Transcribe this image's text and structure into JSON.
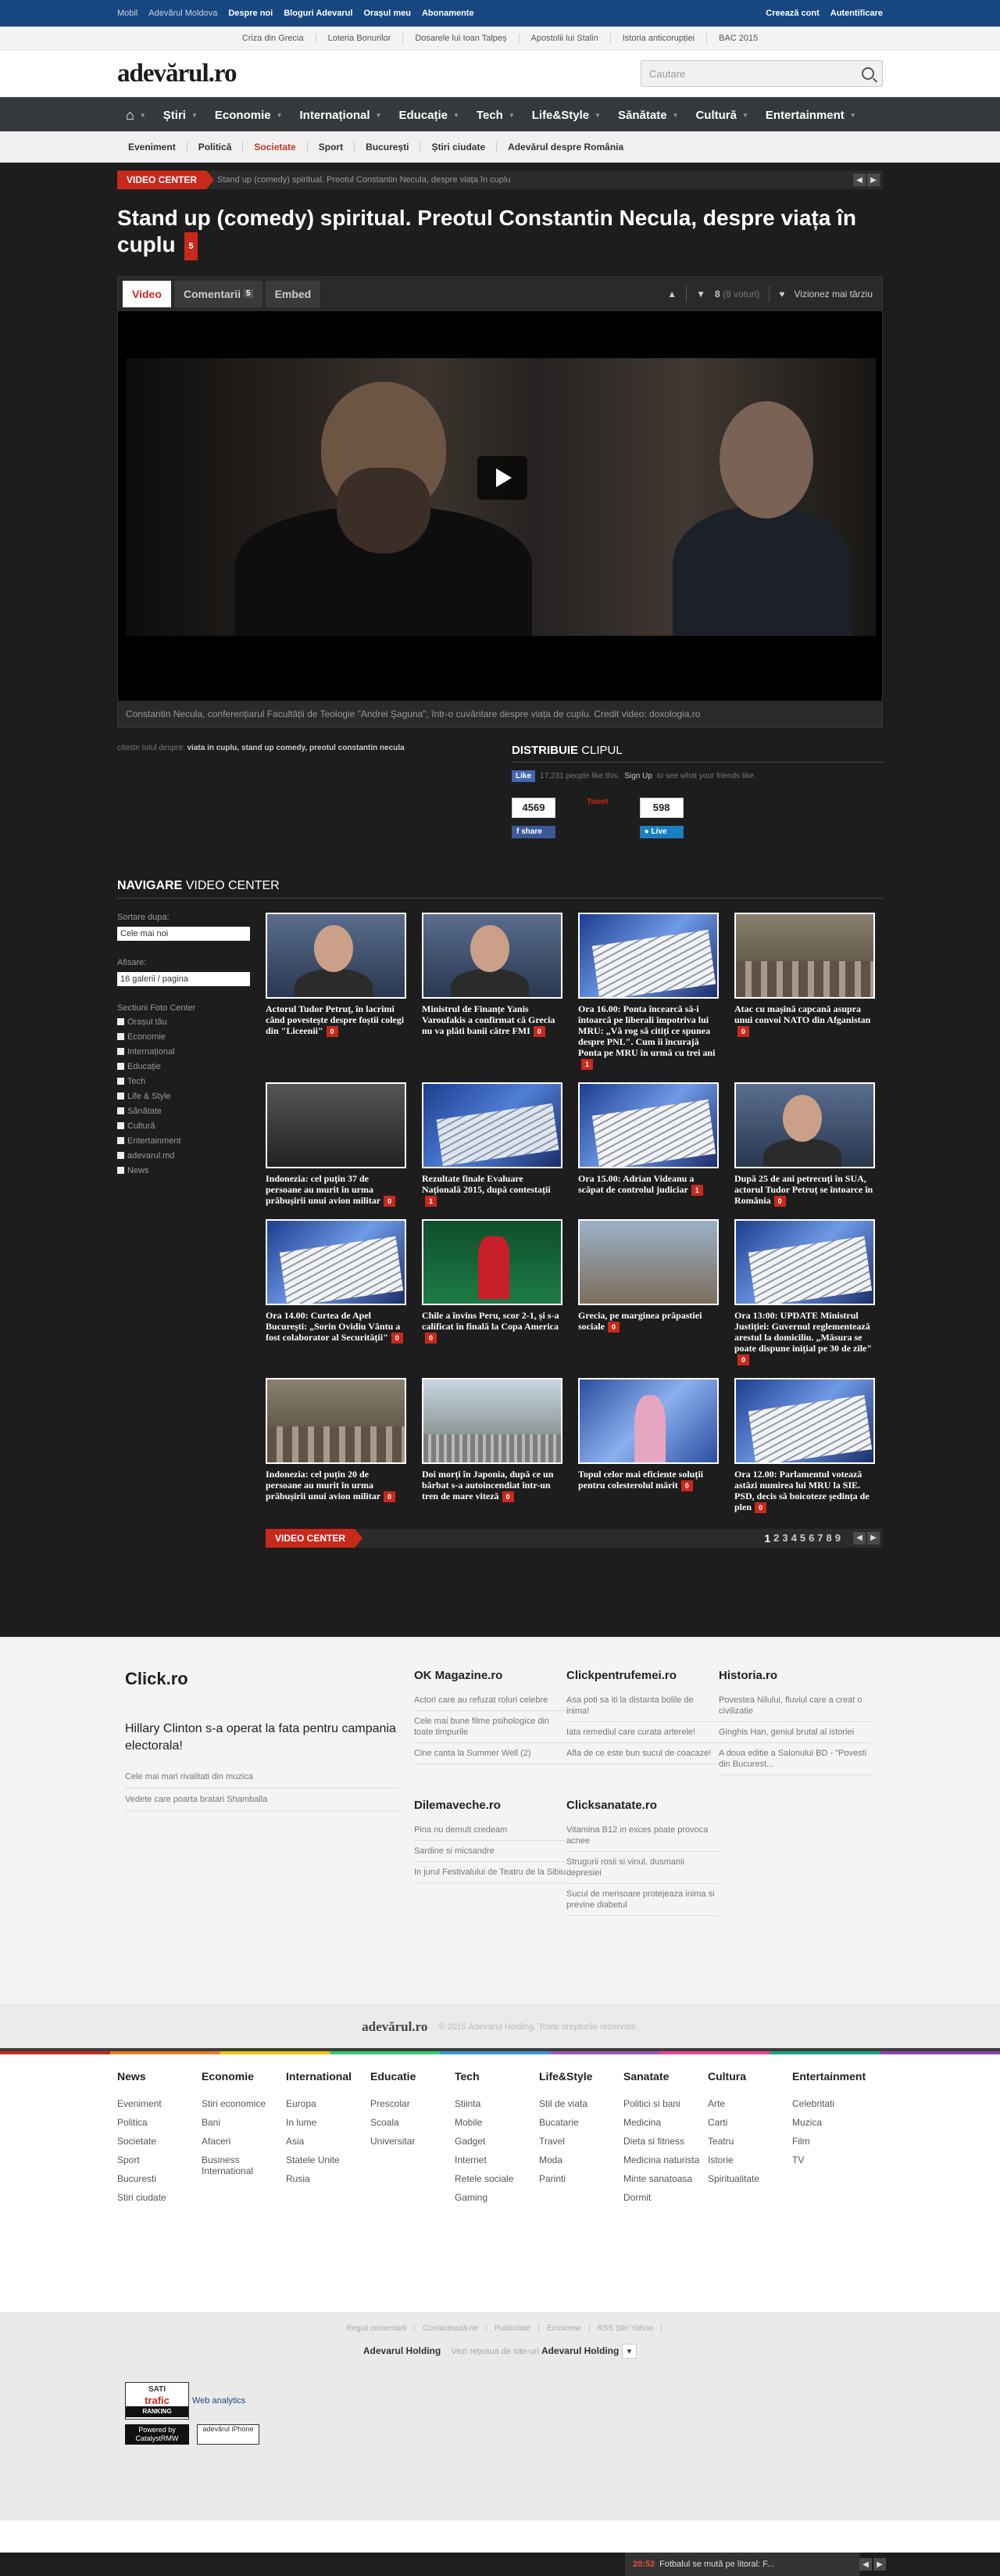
{
  "topbar": {
    "mobil": "Mobil",
    "moldova": "Adevărul Moldova",
    "despre": "Despre noi",
    "bloguri": "Bloguri Adevarul",
    "orasul": "Orașul meu",
    "abonamente": "Abonamente",
    "creeaza": "Creează cont",
    "auth": "Autentificare"
  },
  "subtop": [
    "Criza din Grecia",
    "Loteria Bonurilor",
    "Dosarele lui Ioan Talpeș",
    "Apostolii lui Stalin",
    "Istoria anticorupției",
    "BAC 2015"
  ],
  "header": {
    "logo": "adevărul.ro",
    "search_placeholder": "Cautare"
  },
  "mainnav": [
    "Știri",
    "Economie",
    "Internațional",
    "Educație",
    "Tech",
    "Life&Style",
    "Sănătate",
    "Cultură",
    "Entertainment"
  ],
  "subnav": [
    "Eveniment",
    "Politică",
    "Societate",
    "Sport",
    "București",
    "Știri ciudate",
    "Adevărul despre România"
  ],
  "videocenter": {
    "label": "VIDEO CENTER",
    "crumb": "Stand up (comedy) spiritual. Preotul Constantin Necula, despre viața în cuplu",
    "title": "Stand up (comedy) spiritual. Preotul Constantin Necula, despre viața în cuplu",
    "comments": "5"
  },
  "player": {
    "tab_video": "Video",
    "tab_comments": "Comentarii",
    "tab_comments_count": "5",
    "tab_embed": "Embed",
    "votes": "8",
    "votes_note": "(8 voturi)",
    "watch_later": "Vizionez mai târziu",
    "caption": "Constantin Necula, conferențiarul Facultății de Teologie \"Andrei Şaguna\", într-o cuvântare despre viața de cuplu. Credit video: doxologia.ro"
  },
  "tags": {
    "label": "citeste totul despre:",
    "items": "viata in cuplu, stand up comedy, preotul constantin necula"
  },
  "distribuie": {
    "title_b": "DISTRIBUIE",
    "title_n": "CLIPUL",
    "fb_like": "Like",
    "fb_text": "17,231 people like this.",
    "fb_signup": "Sign Up",
    "fb_text2": "to see what your friends like.",
    "fb_count": "4569",
    "fb_share": "share",
    "tweet": "Tweet",
    "live_count": "598",
    "live": "Live"
  },
  "navigare": {
    "title_b": "NAVIGARE",
    "title_n": "VIDEO CENTER",
    "sort_label": "Sortare dupa:",
    "sort_value": "Cele mai noi",
    "show_label": "Afisare:",
    "show_value": "16 galerii / pagina",
    "sections_label": "Sectiuni Foto Center",
    "sections": [
      "Orașul tău",
      "Economie",
      "Internațional",
      "Educație",
      "Tech",
      "Life & Style",
      "Sănătate",
      "Cultură",
      "Entertainment",
      "adevarul.md",
      "News"
    ]
  },
  "cards": [
    {
      "title": "Actorul Tudor Petruț, în lacrimi când povestește despre foștii colegi din \"Liceenii\"",
      "comments": "0"
    },
    {
      "title": "Ministrul de Finanțe Yanis Varoufakis a confirmat că Grecia nu va plăti banii către FMI",
      "comments": "0"
    },
    {
      "title": "Ora 16.00: Ponta încearcă să-i întoarcă pe liberali împotriva lui MRU: „Vă rog să citiți ce spunea despre PNL\". Cum îi încurajă Ponta pe MRU în urmă cu trei ani",
      "comments": "1"
    },
    {
      "title": "Atac cu mașină capcană asupra unui convoi NATO din Afganistan",
      "comments": "0"
    },
    {
      "title": "Indonezia: cel puțin 37 de persoane au murit în urma prăbușirii unui avion militar",
      "comments": "0"
    },
    {
      "title": "Rezultate finale Evaluare Națională 2015, după contestații",
      "comments": "1"
    },
    {
      "title": "Ora 15.00: Adrian Videanu a scăpat de controlul judiciar",
      "comments": "1"
    },
    {
      "title": "După 25 de ani petrecuți în SUA, actorul Tudor Petruț se întoarce în România",
      "comments": "0"
    },
    {
      "title": "Ora 14.00: Curtea de Apel București: „Sorin Ovidiu Vântu a fost colaborator al Securității\"",
      "comments": "0"
    },
    {
      "title": "Chile a învins Peru, scor 2-1, și s-a calificat în finală la Copa America",
      "comments": "0"
    },
    {
      "title": "Grecia, pe marginea prăpastiei sociale",
      "comments": "0"
    },
    {
      "title": "Ora 13:00: UPDATE Ministrul Justiției: Guvernul reglementează arestul la domiciliu. „Măsura se poate dispune inițial pe 30 de zile\"",
      "comments": "0"
    },
    {
      "title": "Indonezia: cel puțin 20 de persoane au murit în urma prăbușirii unui avion militar",
      "comments": "0"
    },
    {
      "title": "Doi morți în Japonia, după ce un bărbat s-a autoincendiat într-un tren de mare viteză",
      "comments": "0"
    },
    {
      "title": "Topul celor mai eficiente soluții pentru colesterolul mărit",
      "comments": "0"
    },
    {
      "title": "Ora 12.00: Parlamentul votează astăzi numirea lui MRU la SIE. PSD, decis să boicoteze ședința de plen",
      "comments": "0"
    }
  ],
  "pagination": {
    "label": "VIDEO CENTER",
    "pages": [
      "1",
      "2",
      "3",
      "4",
      "5",
      "6",
      "7",
      "8",
      "9"
    ]
  },
  "partners": {
    "main": {
      "site": "Click.ro",
      "headline": "Hillary Clinton s-a operat la fata pentru campania electorala!",
      "links": [
        "Cele mai mari rivalitati din muzica",
        "Vedete care poarta bratari Shamballa"
      ]
    },
    "cols": [
      {
        "site": "OK Magazine.ro",
        "links": [
          "Actori care au refuzat roluri celebre",
          "Cele mai bune filme psihologice din toate timpurile",
          "Cine canta la Summer Well (2)"
        ]
      },
      {
        "site": "Clickpentrufemei.ro",
        "links": [
          "Asa poti sa iti la distanta bolile de inima!",
          "Iata remediul care curata arterele!",
          "Afla de ce este bun sucul de coacaze!"
        ]
      },
      {
        "site": "Historia.ro",
        "links": [
          "Povestea Nilului, fluviul care a creat o civilizatie",
          "Ginghis Han, geniul brutal al istoriei",
          "A doua editie a Salonului BD - \"Povesti din Bucurest..."
        ]
      },
      {
        "site": "Dilemaveche.ro",
        "links": [
          "Pina nu demult credeam",
          "Sardine si micsandre",
          "In jurul Festivalului de Teatru de la Sibiu"
        ]
      },
      {
        "site": "Clicksanatate.ro",
        "links": [
          "Vitamina B12 in exces poate provoca acnee",
          "Strugurii rosii si vinul, dusmanii depresiei",
          "Sucul de merisoare protejeaza inima si previne diabetul"
        ]
      }
    ]
  },
  "copyright": {
    "logo": "adevărul.ro",
    "text": "© 2015 Adevarul Holding. Toate drepturile rezervate."
  },
  "sitemap": [
    {
      "h": "News",
      "l": [
        "Eveniment",
        "Politica",
        "Societate",
        "Sport",
        "Bucuresti",
        "Stiri ciudate"
      ]
    },
    {
      "h": "Economie",
      "l": [
        "Stiri economice",
        "Bani",
        "Afaceri",
        "Business International"
      ]
    },
    {
      "h": "International",
      "l": [
        "Europa",
        "In lume",
        "Asia",
        "Statele Unite",
        "Rusia"
      ]
    },
    {
      "h": "Educatie",
      "l": [
        "Prescolar",
        "Scoala",
        "Universitar"
      ]
    },
    {
      "h": "Tech",
      "l": [
        "Stiinta",
        "Mobile",
        "Gadget",
        "Internet",
        "Retele sociale",
        "Gaming"
      ]
    },
    {
      "h": "Life&Style",
      "l": [
        "Stil de viata",
        "Bucatarie",
        "Travel",
        "Moda",
        "Parinti"
      ]
    },
    {
      "h": "Sanatate",
      "l": [
        "Politici si bani",
        "Medicina",
        "Dieta si fitness",
        "Medicina naturista",
        "Minte sanatoasa",
        "Dormit"
      ]
    },
    {
      "h": "Cultura",
      "l": [
        "Arte",
        "Carti",
        "Teatru",
        "Istorie",
        "Spiritualitate"
      ]
    },
    {
      "h": "Entertainment",
      "l": [
        "Celebritati",
        "Muzica",
        "Film",
        "TV"
      ]
    }
  ],
  "footer": {
    "links": [
      "Reguli comentarii",
      "Contactează-ne",
      "Publicitate",
      "Ecuscrew",
      "RSS Știri Yahoo"
    ],
    "holding": "Adevarul Holding",
    "holding_note": "Vezi rețeaua de site-uri",
    "holding_select": "Adevarul Holding",
    "sati_top": "SATI",
    "sati_mid": "trafic",
    "sati_bot": "RANKING",
    "web_analytics": "Web analytics",
    "catalyst": "Powered by CatalystRMW",
    "iphone": "adevărul iPhone"
  },
  "ticker": {
    "time": "20:52",
    "text": "Fotbalul se mută pe litoral: F..."
  }
}
